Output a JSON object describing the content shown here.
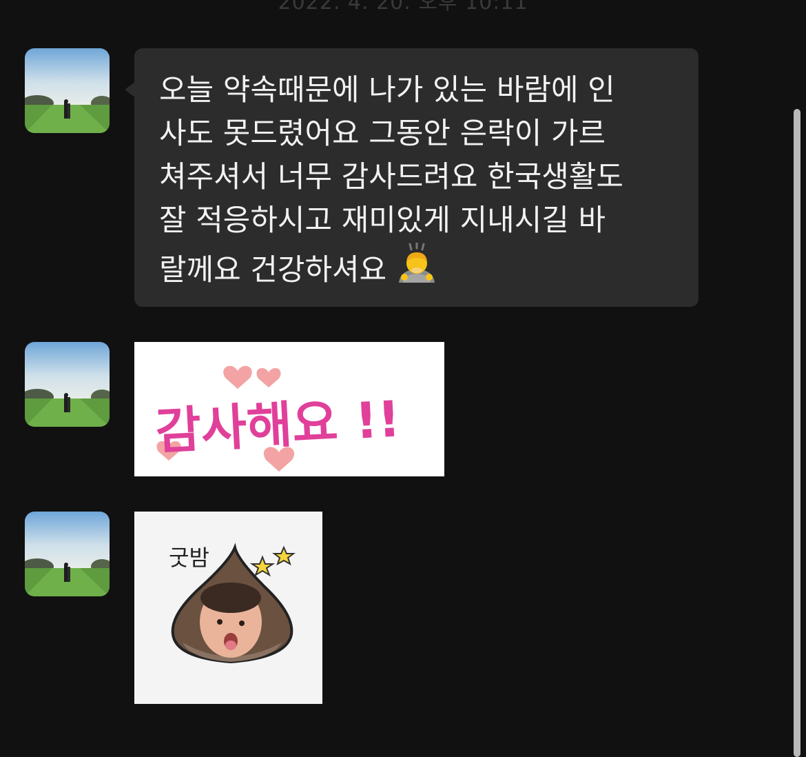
{
  "header": {
    "date_label": "2022. 4. 20. 오후 10:11"
  },
  "messages": [
    {
      "type": "text",
      "lines": [
        "오늘 약속때문에 나가 있는 바람에 인",
        "사도 못드렸어요 그동안 은락이 가르",
        "쳐주셔서 너무 감사드려요 한국생활도",
        "잘 적응하시고 재미있게 지내시길 바",
        "랄께요 건강하셔요"
      ],
      "emoji": "bowing-person-emoji"
    },
    {
      "type": "sticker",
      "sticker_text": "감사해요 !!"
    },
    {
      "type": "sticker",
      "sticker_text": "굿밤"
    }
  ],
  "colors": {
    "background": "#111111",
    "bubble": "#2c2c2c",
    "text": "#f2f2f2",
    "sticker_pink": "#e0409a",
    "heart_pink": "#f3a3a3",
    "scrollbar": "#b9b9b9"
  }
}
